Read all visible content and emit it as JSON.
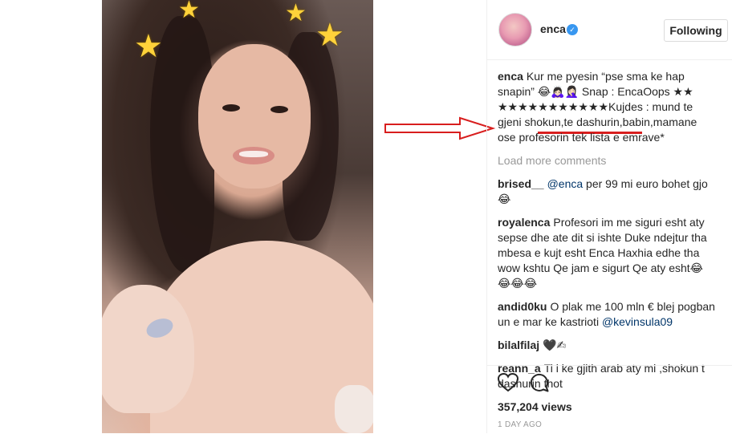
{
  "post": {
    "username": "enca",
    "follow_label": "Following",
    "caption_user": "enca",
    "caption_text": "Kur me pyesin “pse sma ke hap snapin” 😂🙇🏻‍♀️🤦🏻‍♀️ Snap : EncaOops ★★ ★★★★★★★★★★★Kujdes : mund te gjeni shokun,te dashurin,babin,mamane ose profesorin tek lista e emrave*",
    "load_more": "Load more comments",
    "comments": [
      {
        "user": "brised__",
        "mention": "@enca",
        "text": " per 99 mi euro bohet gjo 😂"
      },
      {
        "user": "royalenca",
        "mention": "",
        "text": "Profesori im me siguri esht aty sepse dhe ate dit si ishte Duke ndejtur tha mbesa e kujt esht Enca Haxhia edhe tha wow kshtu Qe jam e sigurt Qe aty esht😂😂😂😂"
      },
      {
        "user": "andid0ku",
        "mention": "",
        "text": "O plak me 100 mln € blej pogban un e mar ke kastrioti ",
        "mention_end": "@kevinsula09"
      },
      {
        "user": "bilalfilaj",
        "mention": "",
        "text": "🖤✍"
      },
      {
        "user": "reann_a",
        "mention": "",
        "text": "Ti i ke gjith arab aty mi ,shokun t dashurin thot"
      }
    ],
    "views": "357,204 views",
    "time_ago": "1 DAY AGO"
  },
  "icons": {
    "verified": "verified-badge-icon",
    "like": "heart-icon",
    "comment": "comment-bubble-icon"
  },
  "colors": {
    "verified": "#3897f0",
    "mention": "#003569",
    "annotation": "#d81e1e"
  }
}
